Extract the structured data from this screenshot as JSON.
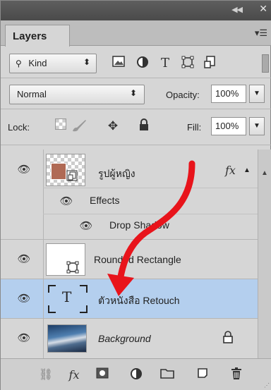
{
  "panel": {
    "top_strip": {
      "collapse_icon": "double-chevron-left",
      "close_icon": "close"
    },
    "tab_label": "Layers",
    "tab_menu_icon": "panel-menu"
  },
  "filter": {
    "kind_label": "Kind",
    "kind_icon": "search",
    "icons": [
      "image-filter",
      "adjustment-filter",
      "type-filter",
      "shape-filter",
      "smart-object-filter"
    ],
    "type_icon_glyph": "T"
  },
  "blend": {
    "mode": "Normal",
    "opacity_label": "Opacity:",
    "opacity_value": "100%"
  },
  "lock": {
    "label": "Lock:",
    "icons": [
      "lock-transparency",
      "lock-paint",
      "lock-position",
      "lock-all"
    ],
    "fill_label": "Fill:",
    "fill_value": "100%"
  },
  "layers": [
    {
      "name": "รูปผู้หญิง",
      "visible": true,
      "fx": "fx",
      "effects_label": "Effects",
      "effect": "Drop Shadow"
    },
    {
      "name": "Rounded Rectangle",
      "visible": true
    },
    {
      "name": "ตัวหนังสือ Retouch",
      "visible": true,
      "selected": true,
      "type_glyph": "T"
    },
    {
      "name": "Background",
      "visible": true,
      "locked": true
    }
  ],
  "bottom_toolbar": [
    "link-layers",
    "add-layer-style",
    "add-mask",
    "new-adjustment-layer",
    "new-group",
    "new-layer",
    "delete-layer"
  ],
  "colors": {
    "selected_row": "#b4cfee",
    "annotation_arrow": "#e8141b",
    "panel_bg": "#d6d6d6"
  }
}
